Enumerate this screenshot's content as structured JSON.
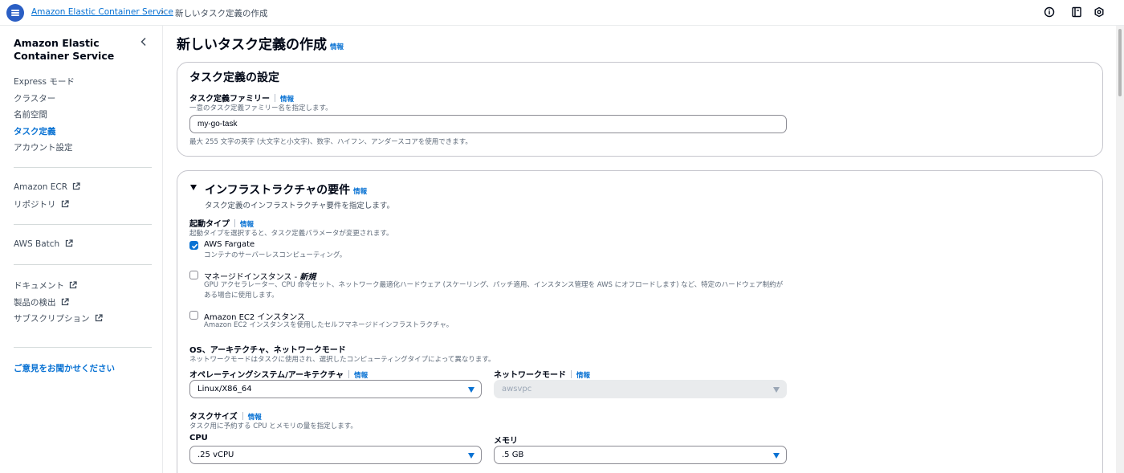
{
  "breadcrumb": {
    "service": "Amazon Elastic Container Service",
    "separator": "›",
    "current": "新しいタスク定義の作成"
  },
  "nav": {
    "title": "Amazon Elastic Container Service",
    "items": [
      {
        "label": "Express モード"
      },
      {
        "label": "クラスター"
      },
      {
        "label": "名前空間"
      },
      {
        "label": "タスク定義",
        "active": true
      },
      {
        "label": "アカウント設定"
      }
    ],
    "ecr": [
      {
        "label": "Amazon ECR"
      },
      {
        "label": "リポジトリ"
      }
    ],
    "batch": [
      {
        "label": "AWS Batch"
      }
    ],
    "docs": [
      {
        "label": "ドキュメント"
      },
      {
        "label": "製品の検出"
      },
      {
        "label": "サブスクリプション"
      }
    ],
    "feedback": "ご意見をお聞かせください"
  },
  "page": {
    "title": "新しいタスク定義の作成",
    "info": "情報"
  },
  "task_config": {
    "heading": "タスク定義の設定",
    "family_label": "タスク定義ファミリー",
    "family_info": "情報",
    "family_desc": "一意のタスク定義ファミリー名を指定します。",
    "family_value": "my-go-task",
    "family_hint": "最大 255 文字の英字 (大文字と小文字)、数字、ハイフン、アンダースコアを使用できます。"
  },
  "infra": {
    "heading": "インフラストラクチャの要件",
    "info": "情報",
    "desc": "タスク定義のインフラストラクチャ要件を指定します。",
    "launch_label": "起動タイプ",
    "launch_info": "情報",
    "launch_desc": "起動タイプを選択すると、タスク定義パラメータが変更されます。",
    "options": [
      {
        "label": "AWS Fargate",
        "desc": "コンテナのサーバーレスコンピューティング。",
        "checked": true
      },
      {
        "label": "マネージドインスタンス - ",
        "badge": "新規",
        "desc": "GPU アクセラレーター、CPU 命令セット、ネットワーク最適化ハードウェア (スケーリング、パッチ適用、インスタンス管理を AWS にオフロードします) など、特定のハードウェア制約がある場合に使用します。",
        "checked": false
      },
      {
        "label": "Amazon EC2 インスタンス",
        "desc": "Amazon EC2 インスタンスを使用したセルフマネージドインフラストラクチャ。",
        "checked": false
      }
    ],
    "os_section_label": "OS、アーキテクチャ、ネットワークモード",
    "os_section_desc": "ネットワークモードはタスクに使用され、選択したコンピューティングタイプによって異なります。",
    "os_label": "オペレーティングシステム/アーキテクチャ",
    "os_info": "情報",
    "os_value": "Linux/X86_64",
    "network_label": "ネットワークモード",
    "network_info": "情報",
    "network_value": "awsvpc",
    "size_label": "タスクサイズ",
    "size_info": "情報",
    "size_desc": "タスク用に予約する CPU とメモリの量を指定します。",
    "cpu_label": "CPU",
    "cpu_value": ".25 vCPU",
    "memory_label": "メモリ",
    "memory_value": ".5 GB"
  },
  "icons": {
    "menu": "menu-icon",
    "info": "info-circle-icon",
    "panel": "side-panel-icon",
    "settings": "settings-icon",
    "external": "external-link-icon",
    "close": "chevron-left-icon"
  },
  "colors": {
    "link": "#0972d3",
    "menu_button": "#2a5ec4",
    "text": "#000716",
    "muted": "#5f6b7a"
  }
}
